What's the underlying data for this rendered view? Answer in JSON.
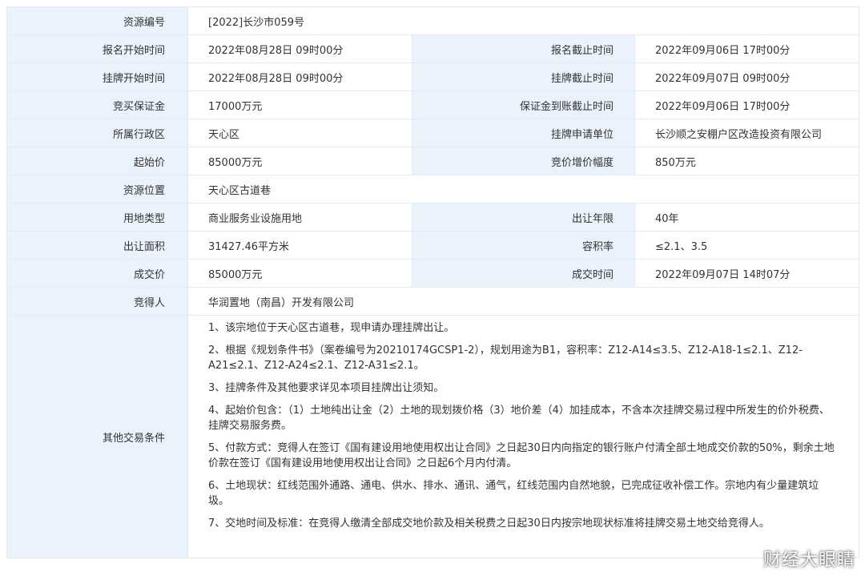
{
  "rows": {
    "r1": {
      "l1": "资源编号",
      "v1": "[2022]长沙市059号"
    },
    "r2": {
      "l1": "报名开始时间",
      "v1": "2022年08月28日 09时00分",
      "l2": "报名截止时间",
      "v2": "2022年09月06日 17时00分"
    },
    "r3": {
      "l1": "挂牌开始时间",
      "v1": "2022年08月28日 09时00分",
      "l2": "挂牌截止时间",
      "v2": "2022年09月07日 09时00分"
    },
    "r4": {
      "l1": "竞买保证金",
      "v1": "17000万元",
      "l2": "保证金到账截止时间",
      "v2": "2022年09月06日 17时00分"
    },
    "r5": {
      "l1": "所属行政区",
      "v1": "天心区",
      "l2": "挂牌申请单位",
      "v2": "长沙顺之安棚户区改造投资有限公司"
    },
    "r6": {
      "l1": "起始价",
      "v1": "85000万元",
      "l2": "竞价增价幅度",
      "v2": "850万元"
    },
    "r7": {
      "l1": "资源位置",
      "v1": "天心区古道巷"
    },
    "r8": {
      "l1": "用地类型",
      "v1": "商业服务业设施用地",
      "l2": "出让年限",
      "v2": "40年"
    },
    "r9": {
      "l1": "出让面积",
      "v1": "31427.46平方米",
      "l2": "容积率",
      "v2": "≤2.1、3.5"
    },
    "r10": {
      "l1": "成交价",
      "v1": "85000万元",
      "l2": "成交时间",
      "v2": "2022年09月07日 14时07分"
    },
    "r11": {
      "l1": "竞得人",
      "v1": "华润置地（南昌）开发有限公司"
    }
  },
  "conditions": {
    "label": "其他交易条件",
    "items": [
      "1、该宗地位于天心区古道巷，现申请办理挂牌出让。",
      "2、根据《规划条件书》（案卷编号为20210174GCSP1-2），规划用途为B1，容积率：Z12-A14≤3.5、Z12-A18-1≤2.1、Z12-A21≤2.1、Z12-A24≤2.1、Z12-A31≤2.1。",
      "3、挂牌条件及其他要求详见本项目挂牌出让须知。",
      "4、起始价包含：（1）土地纯出让金（2）土地的现划拨价格（3）地价差（4）加挂成本，不含本次挂牌交易过程中所发生的价外税费、挂牌交易服务费。",
      "5、付款方式：竞得人在签订《国有建设用地使用权出让合同》之日起30日内向指定的银行账户付清全部土地成交价款的50%，剩余土地价款在签订《国有建设用地使用权出让合同》之日起6个月内付清。",
      "6、土地现状：红线范围外通路、通电、供水、排水、通讯、通气，红线范围内自然地貌，已完成征收补偿工作。宗地内有少量建筑垃圾。",
      "7、交地时间及标准：在竞得人缴清全部成交地价款及相关税费之日起30日内按宗地现状标准将挂牌交易土地交给竞得人。"
    ]
  },
  "watermark": "财经大眼睛"
}
